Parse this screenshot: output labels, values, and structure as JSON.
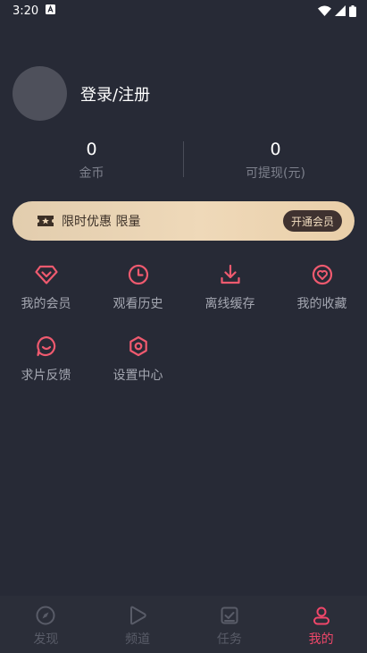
{
  "status_bar": {
    "time": "3:20",
    "icons": [
      "notification-a-icon",
      "wifi-icon",
      "cell-signal-icon",
      "battery-icon"
    ]
  },
  "profile": {
    "login_text": "登录/注册"
  },
  "stats": [
    {
      "value": "0",
      "label": "金币"
    },
    {
      "value": "0",
      "label": "可提现(元)"
    }
  ],
  "vip_banner": {
    "text": "限时优惠 限量",
    "button_label": "开通会员",
    "icon": "ticket-star-icon"
  },
  "menu": [
    {
      "label": "我的会员",
      "icon": "diamond-icon"
    },
    {
      "label": "观看历史",
      "icon": "clock-icon"
    },
    {
      "label": "离线缓存",
      "icon": "download-icon"
    },
    {
      "label": "我的收藏",
      "icon": "heart-icon"
    },
    {
      "label": "求片反馈",
      "icon": "feedback-icon"
    },
    {
      "label": "设置中心",
      "icon": "settings-icon"
    }
  ],
  "bottom_nav": [
    {
      "label": "发现",
      "icon": "compass-icon",
      "active": false
    },
    {
      "label": "频道",
      "icon": "play-icon",
      "active": false
    },
    {
      "label": "任务",
      "icon": "task-icon",
      "active": false
    },
    {
      "label": "我的",
      "icon": "user-icon",
      "active": true
    }
  ],
  "colors": {
    "background": "#272a36",
    "accent": "#f0476a",
    "menu_icon": "#ef5a6f",
    "banner_gold": "#efd9b9"
  }
}
